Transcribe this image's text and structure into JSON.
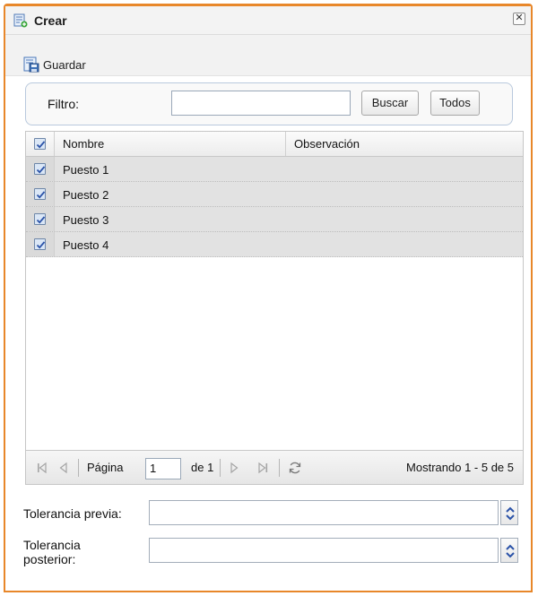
{
  "window": {
    "title": "Crear",
    "close_glyph": "✕"
  },
  "toolbar": {
    "save_label": "Guardar"
  },
  "filter": {
    "label": "Filtro:",
    "input_value": "",
    "search_label": "Buscar",
    "all_label": "Todos"
  },
  "grid": {
    "columns": [
      "Nombre",
      "Observación"
    ],
    "rows": [
      {
        "nombre": "Puesto 1",
        "observacion": "",
        "checked": true
      },
      {
        "nombre": "Puesto 2",
        "observacion": "",
        "checked": true
      },
      {
        "nombre": "Puesto 3",
        "observacion": "",
        "checked": true
      },
      {
        "nombre": "Puesto 4",
        "observacion": "",
        "checked": true
      }
    ],
    "header_checked": true
  },
  "pager": {
    "page_label": "Página",
    "page_value": "1",
    "of_label": "de 1",
    "summary": "Mostrando 1 - 5 de 5"
  },
  "fields": {
    "tolerancia_previa_label": "Tolerancia previa:",
    "tolerancia_previa_value": "",
    "tolerancia_posterior_label_1": "Tolerancia",
    "tolerancia_posterior_label_2": "posterior:",
    "tolerancia_posterior_value": ""
  },
  "colors": {
    "window_border": "#e8872a",
    "row_background": "#e2e2e2",
    "checkbox_check": "#2a52a8"
  },
  "icons": [
    "document-add-icon",
    "close-icon",
    "save-icon",
    "checkbox-checked-icon",
    "first-page-icon",
    "prev-page-icon",
    "next-page-icon",
    "last-page-icon",
    "refresh-icon",
    "spinner-icon"
  ]
}
